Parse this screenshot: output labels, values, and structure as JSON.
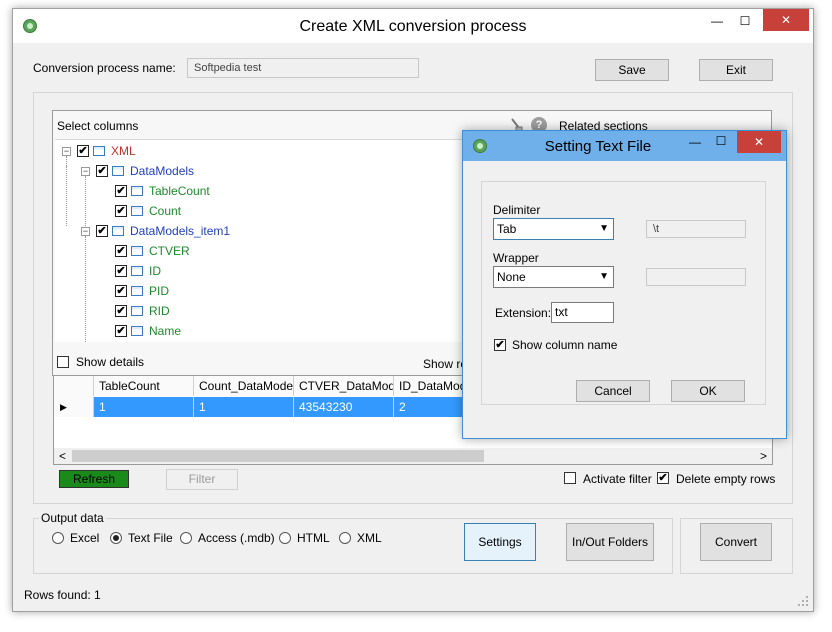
{
  "window": {
    "title": "Create XML conversion process",
    "minimize": "—",
    "maximize": "☐",
    "close": "✕"
  },
  "header": {
    "process_name_label": "Conversion process name:",
    "process_name_value": "Softpedia test",
    "save_label": "Save",
    "exit_label": "Exit"
  },
  "columns_panel": {
    "title": "Select columns",
    "related_sections": "Related sections",
    "show_details": "Show details",
    "show_related": "Show re",
    "tree": [
      {
        "label": "XML",
        "checked": true,
        "color": "#c0302a",
        "level": 0,
        "expander": "−"
      },
      {
        "label": "DataModels",
        "checked": true,
        "color": "#1f3fb8",
        "level": 1,
        "expander": "−"
      },
      {
        "label": "TableCount",
        "checked": true,
        "color": "#1d8a2a",
        "level": 2,
        "expander": ""
      },
      {
        "label": "Count",
        "checked": true,
        "color": "#1d8a2a",
        "level": 2,
        "expander": ""
      },
      {
        "label": "DataModels_item1",
        "checked": true,
        "color": "#1f3fb8",
        "level": 1,
        "expander": "−"
      },
      {
        "label": "CTVER",
        "checked": true,
        "color": "#1d8a2a",
        "level": 2,
        "expander": ""
      },
      {
        "label": "ID",
        "checked": true,
        "color": "#1d8a2a",
        "level": 2,
        "expander": ""
      },
      {
        "label": "PID",
        "checked": true,
        "color": "#1d8a2a",
        "level": 2,
        "expander": ""
      },
      {
        "label": "RID",
        "checked": true,
        "color": "#1d8a2a",
        "level": 2,
        "expander": ""
      },
      {
        "label": "Name",
        "checked": true,
        "color": "#1d8a2a",
        "level": 2,
        "expander": ""
      }
    ]
  },
  "grid": {
    "columns": [
      "TableCount",
      "Count_DataModels",
      "CTVER_DataMode",
      "ID_DataModel"
    ],
    "rows": [
      [
        "1",
        "1",
        "43543230",
        "2"
      ]
    ],
    "row_marker": "▶",
    "scroll_left": "<",
    "scroll_right": ">"
  },
  "grid_toolbar": {
    "refresh_label": "Refresh",
    "filter_label": "Filter",
    "activate_filter": "Activate filter",
    "activate_filter_checked": false,
    "delete_empty_rows": "Delete empty rows",
    "delete_empty_rows_checked": true
  },
  "output": {
    "legend": "Output data",
    "options": [
      "Excel",
      "Text File",
      "Access (.mdb)",
      "HTML",
      "XML"
    ],
    "selected": "Text File",
    "settings_label": "Settings",
    "inout_label": "In/Out Folders",
    "convert_label": "Convert"
  },
  "status": {
    "rows_found": "Rows found: 1"
  },
  "dialog": {
    "title": "Setting Text File",
    "minimize": "—",
    "maximize": "☐",
    "close": "✕",
    "delimiter_label": "Delimiter",
    "delimiter_value": "Tab",
    "delimiter_char": "\\t",
    "wrapper_label": "Wrapper",
    "wrapper_value": "None",
    "extension_label": "Extension:",
    "extension_value": "txt",
    "show_column_name": "Show column name",
    "show_column_name_checked": true,
    "cancel_label": "Cancel",
    "ok_label": "OK"
  },
  "colors": {
    "accent_blue": "#3399ff",
    "refresh_green": "#1a8a1a",
    "dialog_border": "#3b8fd9",
    "close_red": "#c7403a"
  }
}
